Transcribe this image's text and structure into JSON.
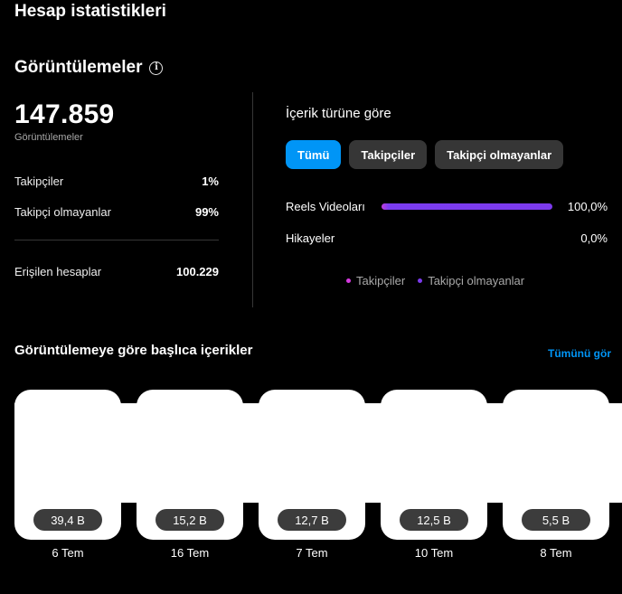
{
  "page_title": "Hesap istatistikleri",
  "views_section": {
    "title": "Görüntülemeler",
    "info_icon": "info-icon",
    "total": "147.859",
    "total_caption": "Görüntülemeler",
    "rows": [
      {
        "label": "Takipçiler",
        "value": "1%"
      },
      {
        "label": "Takipçi olmayanlar",
        "value": "99%"
      },
      {
        "label": "Erişilen hesaplar",
        "value": "100.229"
      }
    ]
  },
  "content_type": {
    "title": "İçerik türüne göre",
    "filters": [
      {
        "label": "Tümü",
        "active": true
      },
      {
        "label": "Takipçiler",
        "active": false
      },
      {
        "label": "Takipçi olmayanlar",
        "active": false
      }
    ],
    "types": [
      {
        "label": "Reels Videoları",
        "value": "100,0%",
        "fill_fraction": 1.0
      },
      {
        "label": "Hikayeler",
        "value": "0,0%",
        "fill_fraction": 0.0
      }
    ],
    "legend": [
      {
        "label": "Takipçiler",
        "color": "#d63ae0"
      },
      {
        "label": "Takipçi olmayanlar",
        "color": "#7c3aed"
      }
    ]
  },
  "top_content": {
    "title": "Görüntülemeye göre başlıca içerikler",
    "see_all": "Tümünü gör",
    "items": [
      {
        "views": "39,4 B",
        "date": "6 Tem"
      },
      {
        "views": "15,2 B",
        "date": "16 Tem"
      },
      {
        "views": "12,7 B",
        "date": "7 Tem"
      },
      {
        "views": "12,5 B",
        "date": "10 Tem"
      },
      {
        "views": "5,5 B",
        "date": "8 Tem"
      }
    ]
  },
  "colors": {
    "accent": "#0095f6",
    "background": "#000000",
    "pill": "#363636",
    "bar": "#7c3aed"
  }
}
